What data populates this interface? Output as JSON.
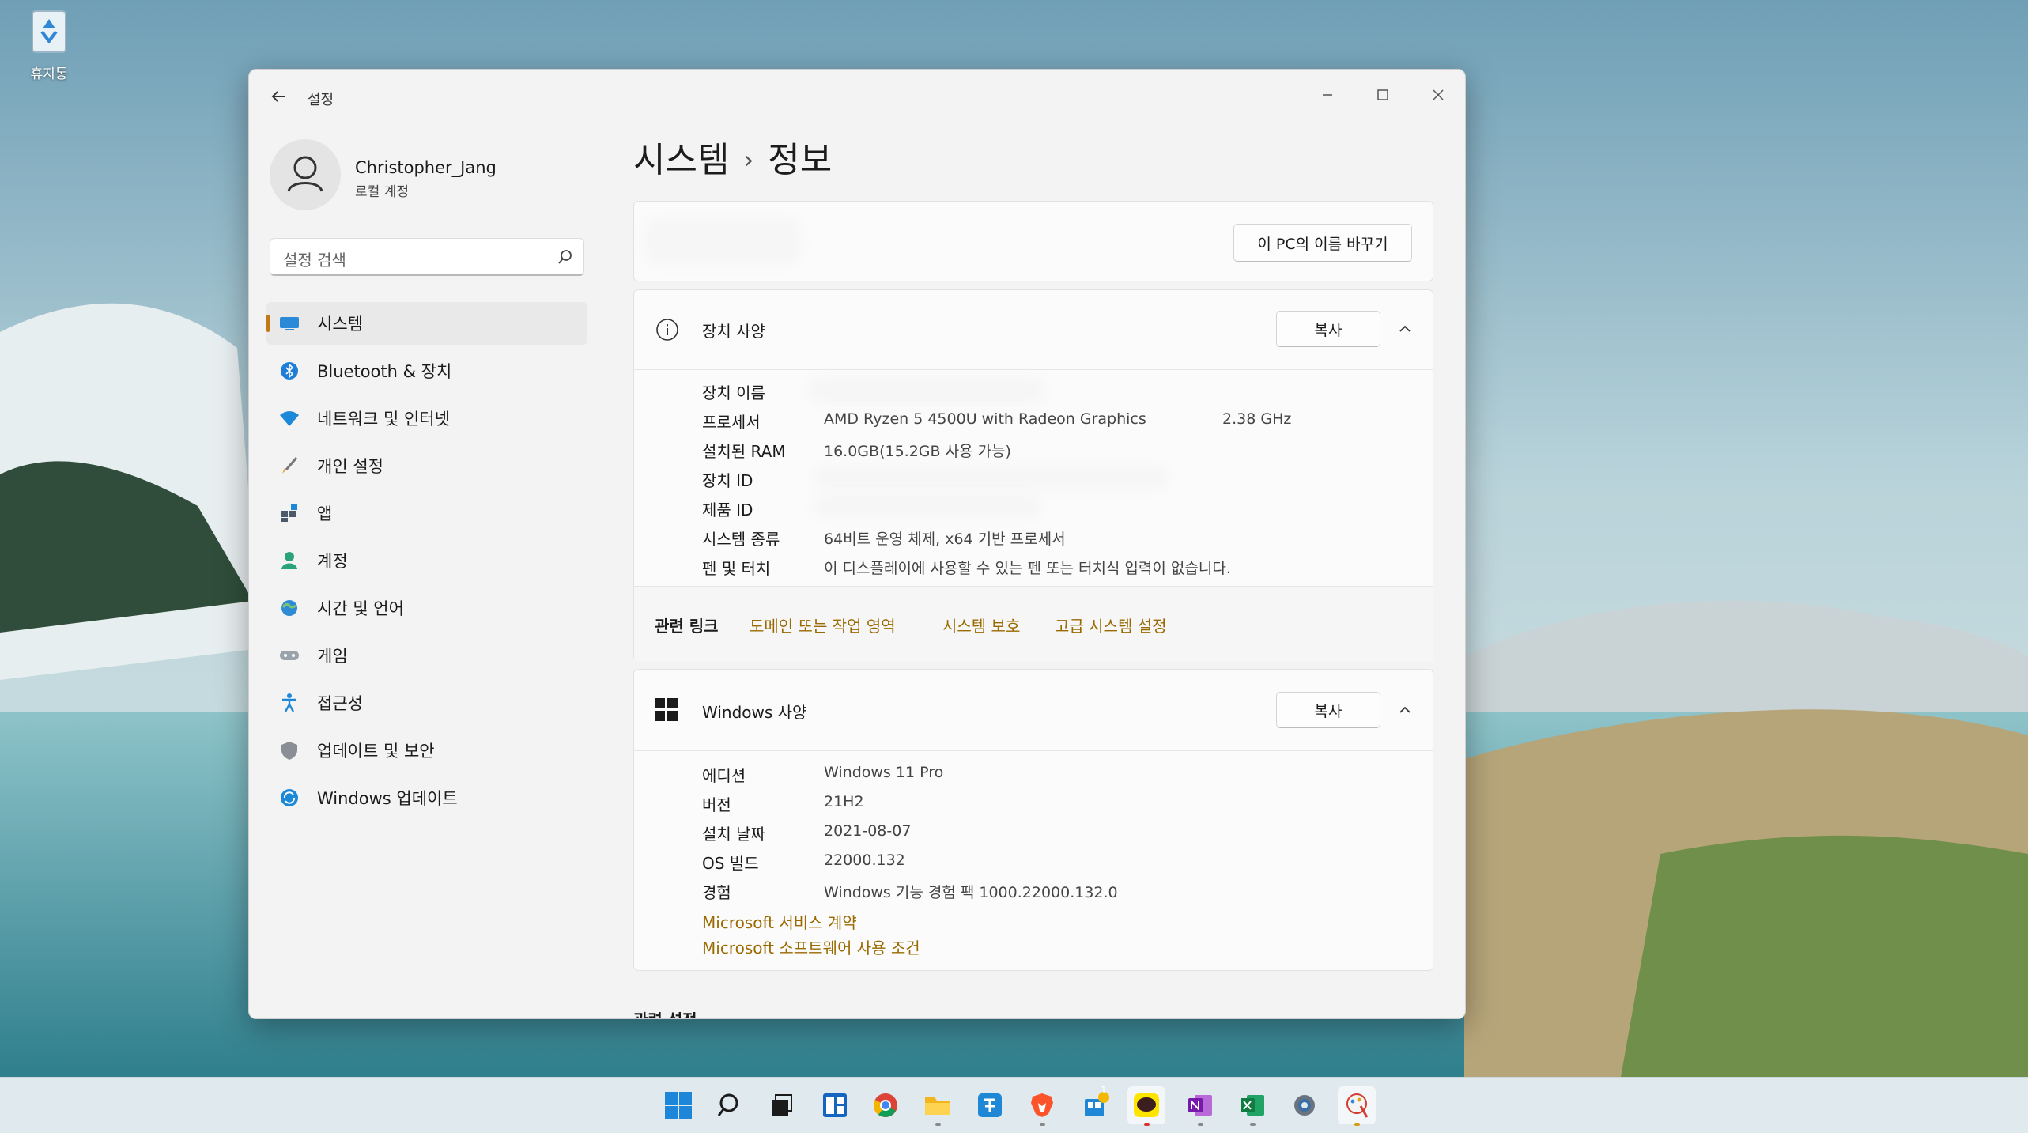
{
  "desktop": {
    "recycle_bin_label": "휴지통"
  },
  "window": {
    "title": "설정",
    "profile": {
      "name": "Christopher_Jang",
      "account_type": "로컬 계정"
    },
    "search": {
      "placeholder": "설정 검색"
    },
    "nav": [
      {
        "label": "시스템",
        "icon": "system-icon",
        "active": true
      },
      {
        "label": "Bluetooth & 장치",
        "icon": "bluetooth-icon"
      },
      {
        "label": "네트워크 및 인터넷",
        "icon": "network-icon"
      },
      {
        "label": "개인 설정",
        "icon": "brush-icon"
      },
      {
        "label": "앱",
        "icon": "apps-icon"
      },
      {
        "label": "계정",
        "icon": "account-icon"
      },
      {
        "label": "시간 및 언어",
        "icon": "globe-icon"
      },
      {
        "label": "게임",
        "icon": "gamepad-icon"
      },
      {
        "label": "접근성",
        "icon": "accessibility-icon"
      },
      {
        "label": "업데이트 및 보안",
        "icon": "shield-icon"
      },
      {
        "label": "Windows 업데이트",
        "icon": "update-icon"
      }
    ],
    "breadcrumb": {
      "parent": "시스템",
      "separator": "›",
      "current": "정보"
    },
    "rename_button": "이 PC의 이름 바꾸기",
    "device_specs": {
      "title": "장치 사양",
      "copy_button": "복사",
      "rows": [
        {
          "label": "장치 이름",
          "value": "",
          "redacted": true
        },
        {
          "label": "프로세서",
          "value": "AMD Ryzen 5 4500U with Radeon Graphics",
          "extra": "2.38 GHz"
        },
        {
          "label": "설치된 RAM",
          "value": "16.0GB(15.2GB 사용 가능)"
        },
        {
          "label": "장치 ID",
          "value": "",
          "redacted": true
        },
        {
          "label": "제품 ID",
          "value": "",
          "redacted": true
        },
        {
          "label": "시스템 종류",
          "value": "64비트 운영 체제, x64 기반 프로세서"
        },
        {
          "label": "펜 및 터치",
          "value": "이 디스플레이에 사용할 수 있는 펜 또는 터치식 입력이 없습니다."
        }
      ]
    },
    "related_links": {
      "label": "관련 링크",
      "links": [
        "도메인 또는 작업 영역",
        "시스템 보호",
        "고급 시스템 설정"
      ]
    },
    "windows_specs": {
      "title": "Windows 사양",
      "copy_button": "복사",
      "rows": [
        {
          "label": "에디션",
          "value": "Windows 11 Pro"
        },
        {
          "label": "버전",
          "value": "21H2"
        },
        {
          "label": "설치 날짜",
          "value": "2021-08-07"
        },
        {
          "label": "OS 빌드",
          "value": "22000.132"
        },
        {
          "label": "경험",
          "value": "Windows 기능 경험 팩 1000.22000.132.0"
        }
      ],
      "links": [
        "Microsoft 서비스 계약",
        "Microsoft 소프트웨어 사용 조건"
      ]
    },
    "related_settings_heading": "관련 설정"
  },
  "taskbar": {
    "icons": [
      "start-icon",
      "search-icon",
      "task-view-icon",
      "widgets-icon",
      "chrome-icon",
      "file-explorer-icon",
      "app-icon",
      "brave-icon",
      "store-icon",
      "kakaotalk-icon",
      "onenote-icon",
      "excel-icon",
      "settings-icon",
      "paint-icon"
    ],
    "badge_count": "1"
  },
  "colors": {
    "accent": "#c07b18",
    "link": "#9a6a00"
  }
}
